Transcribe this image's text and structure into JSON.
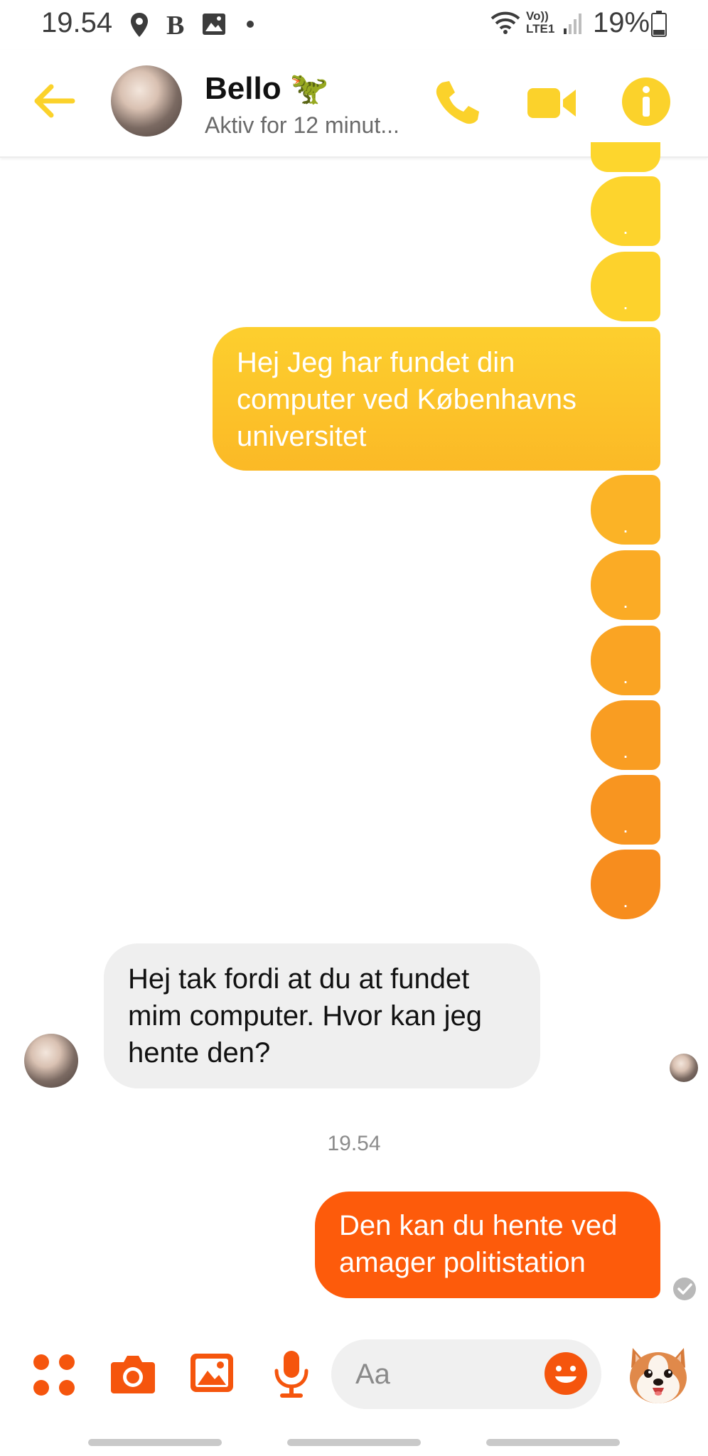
{
  "status_bar": {
    "time": "19.54",
    "icons": [
      "location-icon",
      "bold-b-icon",
      "image-icon",
      "dot-icon",
      "wifi-icon",
      "volte-lte-icon",
      "signal-icon",
      "battery-icon"
    ],
    "volte_label": "Vo)) LTE1",
    "battery": "19%"
  },
  "header": {
    "name": "Bello",
    "emoji": "🦖",
    "status": "Aktiv for 12 minut...",
    "accent": "#fbd22b"
  },
  "messages": {
    "sent_1": "Hej Jeg har fundet din computer ved Københavns universitet",
    "received_1": "Hej tak fordi at du at fundet mim computer. Hvor kan jeg hente den?",
    "timestamp": "19.54",
    "sent_last": "Den kan du hente ved amager politistation",
    "dot": ".",
    "sent_gradient": [
      "#fdd32c",
      "#fbc029",
      "#f99b22",
      "#f77f1c"
    ],
    "last_bubble_color": "#fd5b0b"
  },
  "composer": {
    "placeholder": "Aa",
    "icons": [
      "apps-icon",
      "camera-icon",
      "gallery-icon",
      "microphone-icon",
      "emoji-icon",
      "sticker-avatar-icon"
    ],
    "accent": "#f5550d"
  }
}
